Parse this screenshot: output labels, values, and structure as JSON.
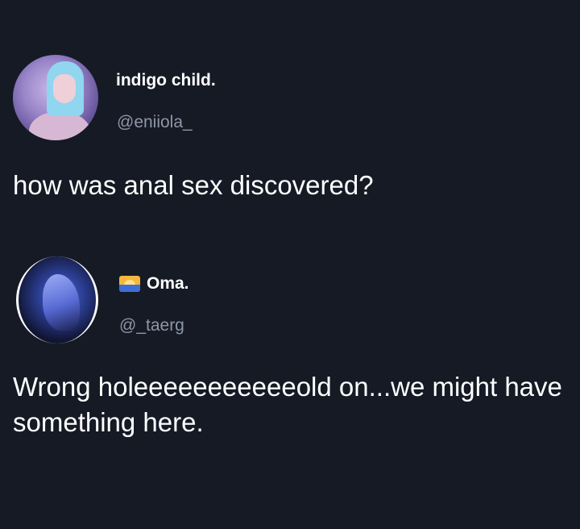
{
  "tweets": [
    {
      "display_name": "indigo child.",
      "handle": "@eniiola_",
      "text": "how was anal sex discovered?"
    },
    {
      "display_name": "Oma.",
      "handle": "@_taerg",
      "text": "Wrong holeeeeeeeeeeeold on...we might have something here."
    }
  ],
  "colors": {
    "background": "#151a25",
    "handle": "#8e97a6",
    "text": "#ffffff"
  },
  "icons": {
    "name_emoji": "sunrise-over-water-icon"
  }
}
